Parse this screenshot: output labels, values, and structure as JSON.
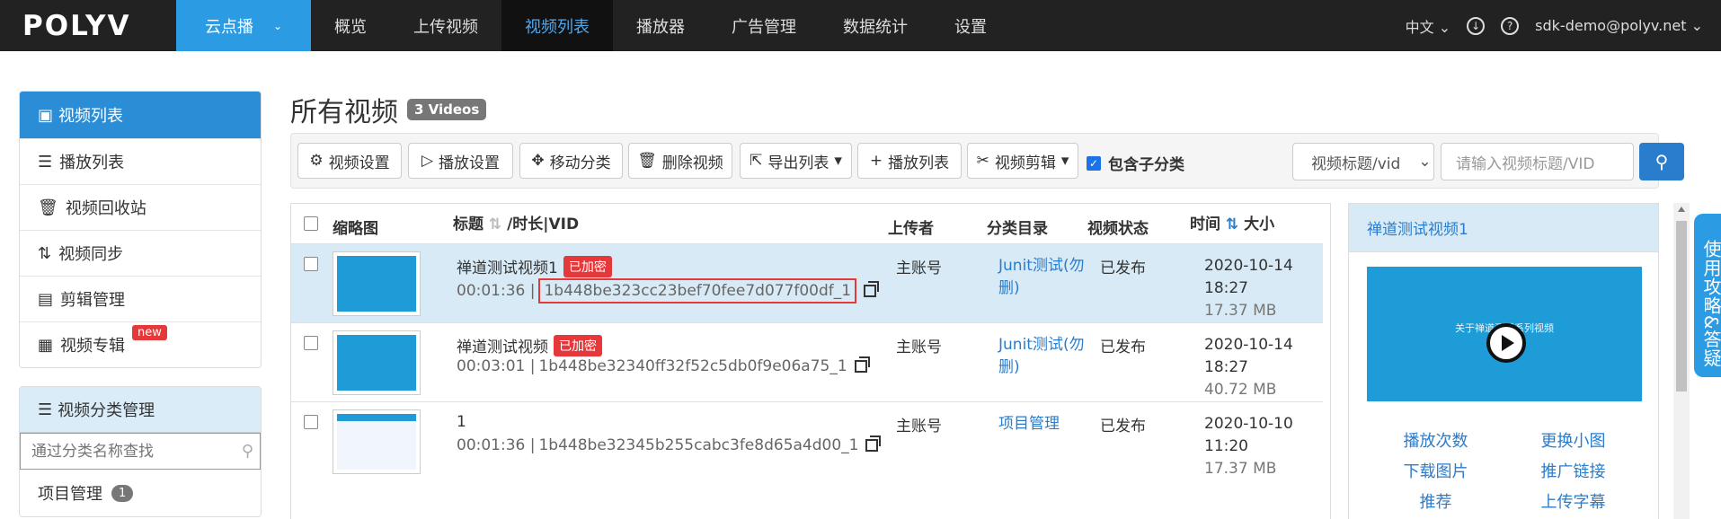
{
  "brand": "POLYV",
  "product_switcher": "云点播",
  "nav": [
    "概览",
    "上传视频",
    "视频列表",
    "播放器",
    "广告管理",
    "数据统计",
    "设置"
  ],
  "nav_active": "视频列表",
  "lang": "中文",
  "user": "sdk-demo@polyv.net",
  "sidebar": {
    "head": "视频列表",
    "items": [
      {
        "label": "播放列表",
        "icon": "list-icon"
      },
      {
        "label": "视频回收站",
        "icon": "trash-icon"
      },
      {
        "label": "视频同步",
        "icon": "sync-icon"
      },
      {
        "label": "剪辑管理",
        "icon": "stack-icon"
      },
      {
        "label": "视频专辑",
        "icon": "grid-icon",
        "badge": "new"
      }
    ]
  },
  "categories": {
    "head": "视频分类管理",
    "search_placeholder": "通过分类名称查找",
    "items": [
      {
        "label": "项目管理",
        "count": "1"
      }
    ]
  },
  "page_title": "所有视频",
  "video_count": "3 Videos",
  "toolbar": {
    "video_settings": "视频设置",
    "play_settings": "播放设置",
    "move_category": "移动分类",
    "delete_video": "删除视频",
    "export_list": "导出列表",
    "playlist": "播放列表",
    "clip": "视频剪辑",
    "include_sub": "包含子分类",
    "search_field": "视频标题/vid",
    "search_placeholder": "请输入视频标题/VID"
  },
  "table": {
    "headers": {
      "thumb": "缩略图",
      "title": "标题",
      "duration_vid": "/时长|VID",
      "uploader": "上传者",
      "category": "分类目录",
      "status": "视频状态",
      "time": "时间",
      "size": "大小"
    },
    "rows": [
      {
        "title": "禅道测试视频1",
        "encrypted": "已加密",
        "duration": "00:01:36 |",
        "vid": "1b448be323cc23bef70fee7d077f00df_1",
        "uploader": "主账号",
        "category": "Junit测试(勿删)",
        "status": "已发布",
        "date": "2020-10-14",
        "clock": "18:27",
        "size": "17.37 MB"
      },
      {
        "title": "禅道测试视频",
        "encrypted": "已加密",
        "duration": "00:03:01 |",
        "vid": "1b448be32340ff32f52c5db0f9e06a75_1",
        "uploader": "主账号",
        "category": "Junit测试(勿删)",
        "status": "已发布",
        "date": "2020-10-14",
        "clock": "18:27",
        "size": "40.72 MB"
      },
      {
        "title": "1",
        "encrypted": "",
        "duration": "00:01:36 |",
        "vid": "1b448be32345b255cabc3fe8d65a4d00_1",
        "uploader": "主账号",
        "category": "项目管理",
        "status": "已发布",
        "date": "2020-10-10",
        "clock": "11:20",
        "size": "17.37 MB"
      }
    ]
  },
  "preview": {
    "title": "禅道测试视频1",
    "video_caption": "关于禅道测试系列视频",
    "links": [
      "播放次数",
      "更换小图",
      "下载图片",
      "推广链接",
      "推荐",
      "上传字幕"
    ]
  },
  "help_tab": "使用攻略&答疑",
  "colors": {
    "accent": "#2b9be3",
    "danger": "#e5383b",
    "link": "#2a7ccc"
  }
}
